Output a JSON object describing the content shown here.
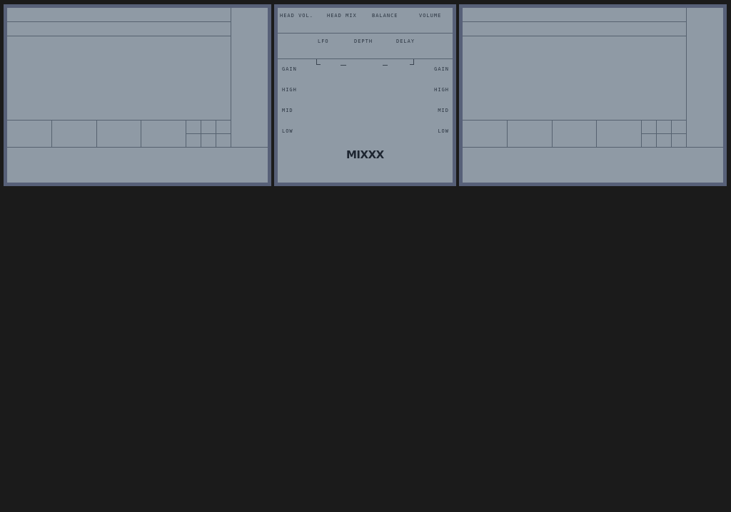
{
  "app": {
    "logo": "MIXXX"
  },
  "mixer": {
    "top_labels": {
      "head_vol": "HEAD VOL.",
      "head_mix": "HEAD MIX",
      "balance": "BALANCE",
      "volume": "VOLUME"
    },
    "flanger_labels": {
      "lfo": "LFO",
      "depth": "DEPTH",
      "delay": "DELAY"
    },
    "eq_left": {
      "gain": "GAIN",
      "high": "HIGH",
      "mid": "MID",
      "low": "LOW"
    },
    "eq_right": {
      "gain": "GAIN",
      "high": "HIGH",
      "mid": "MID",
      "low": "LOW"
    }
  },
  "colors": {
    "background": "#1b1b1b",
    "panel_border": "#576078",
    "panel_face": "#8f9aa5",
    "line": "#566270",
    "text": "#2b3541"
  }
}
